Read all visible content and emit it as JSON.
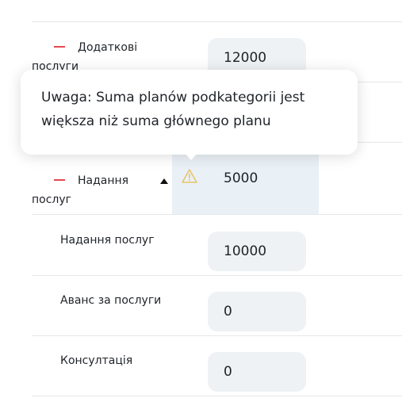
{
  "rows": {
    "dodatkovi": {
      "label": "Додаткові послуги",
      "value": "12000"
    },
    "nadannia_parent": {
      "label": "Надання послуг",
      "value": "5000"
    },
    "nadannia_sub": {
      "label": "Надання послуг",
      "value": "10000"
    },
    "avans": {
      "label": "Аванс за послуги",
      "value": "0"
    },
    "konsultatsiia": {
      "label": "Консултація",
      "value": "0"
    }
  },
  "tooltip": {
    "text": "Uwaga: Suma planów podkategorii jest większa niż suma głównego planu"
  },
  "colors": {
    "minus": "#e5484d",
    "warning": "#e8c36a",
    "field_bg": "#eef2f5",
    "highlight": "#eaf1f6"
  },
  "icons": {
    "warning": "warning-triangle-icon",
    "collapse": "minus-icon",
    "sort": "caret-up-icon"
  }
}
